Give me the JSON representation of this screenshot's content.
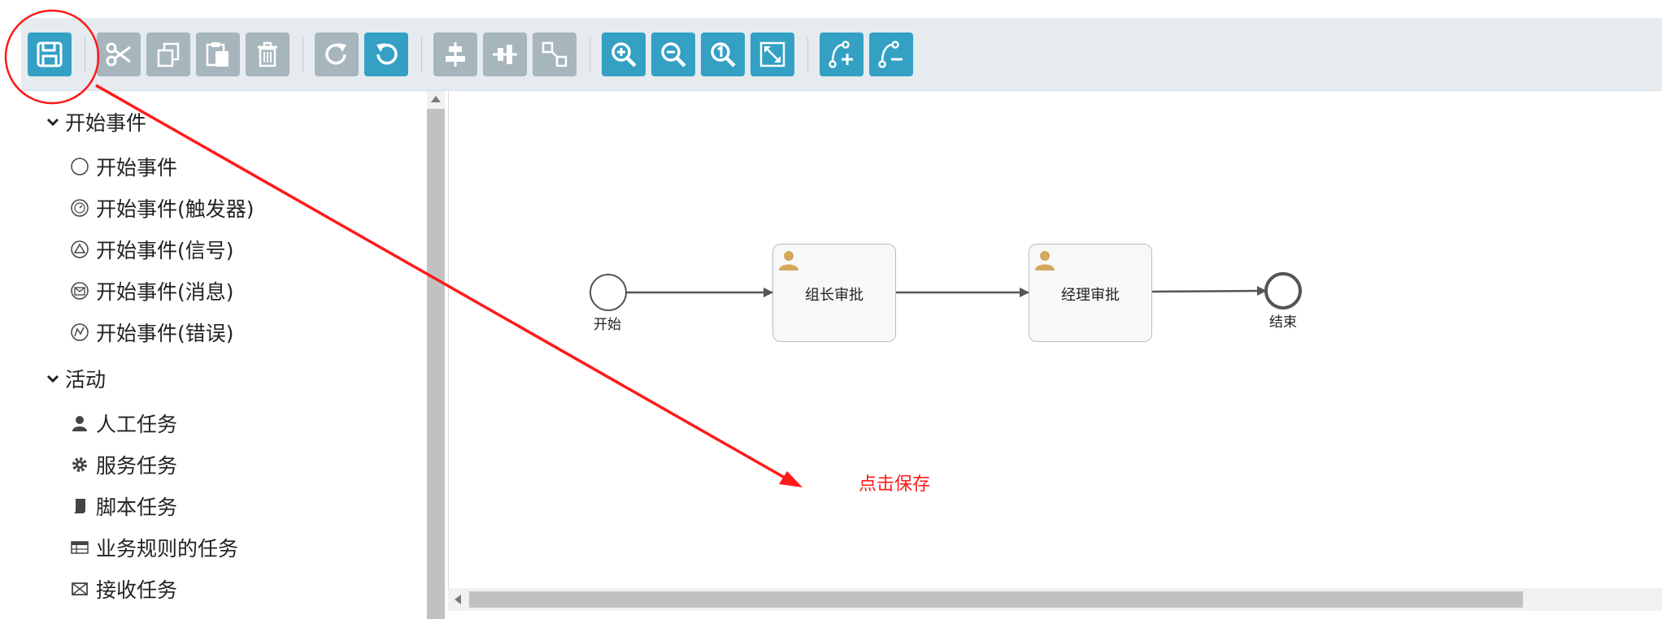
{
  "toolbar": {
    "buttons": [
      {
        "name": "save-button",
        "icon": "save-icon",
        "color": "blue"
      },
      {
        "name": "cut-button",
        "icon": "scissors-icon",
        "color": "gray"
      },
      {
        "name": "copy-button",
        "icon": "copy-icon",
        "color": "gray"
      },
      {
        "name": "paste-button",
        "icon": "paste-icon",
        "color": "gray"
      },
      {
        "name": "delete-button",
        "icon": "trash-icon",
        "color": "gray"
      },
      {
        "name": "redo-button",
        "icon": "redo-icon",
        "color": "gray"
      },
      {
        "name": "undo-button",
        "icon": "undo-icon",
        "color": "blue"
      },
      {
        "name": "align-horizontal-button",
        "icon": "align-horizontal-icon",
        "color": "gray"
      },
      {
        "name": "align-vertical-button",
        "icon": "align-vertical-icon",
        "color": "gray"
      },
      {
        "name": "same-size-button",
        "icon": "same-size-icon",
        "color": "gray"
      },
      {
        "name": "zoom-in-button",
        "icon": "zoom-in-icon",
        "color": "blue"
      },
      {
        "name": "zoom-out-button",
        "icon": "zoom-out-icon",
        "color": "blue"
      },
      {
        "name": "zoom-actual-button",
        "icon": "zoom-actual-icon",
        "color": "blue"
      },
      {
        "name": "zoom-fit-button",
        "icon": "zoom-fit-icon",
        "color": "blue"
      },
      {
        "name": "add-bendpoint-button",
        "icon": "add-bendpoint-icon",
        "color": "blue"
      },
      {
        "name": "remove-bendpoint-button",
        "icon": "remove-bendpoint-icon",
        "color": "blue"
      }
    ]
  },
  "palette": {
    "groups": [
      {
        "label": "开始事件",
        "items": [
          {
            "label": "开始事件",
            "icon": "circle-icon"
          },
          {
            "label": "开始事件(触发器)",
            "icon": "timer-icon"
          },
          {
            "label": "开始事件(信号)",
            "icon": "signal-icon"
          },
          {
            "label": "开始事件(消息)",
            "icon": "message-icon"
          },
          {
            "label": "开始事件(错误)",
            "icon": "error-icon"
          }
        ]
      },
      {
        "label": "活动",
        "items": [
          {
            "label": "人工任务",
            "icon": "user-icon"
          },
          {
            "label": "服务任务",
            "icon": "gear-icon"
          },
          {
            "label": "脚本任务",
            "icon": "script-icon"
          },
          {
            "label": "业务规则的任务",
            "icon": "table-icon"
          },
          {
            "label": "接收任务",
            "icon": "envelope-icon"
          }
        ]
      }
    ]
  },
  "diagram": {
    "start_label": "开始",
    "task1_label": "组长审批",
    "task2_label": "经理审批",
    "end_label": "结束"
  },
  "annotation": {
    "text": "点击保存",
    "color": "#ff1a1a"
  },
  "colors": {
    "accent": "#33a0c4",
    "disabled": "#a7b5bd",
    "toolbar_bg": "#e6ebf0",
    "user_icon": "#d4a85a"
  }
}
